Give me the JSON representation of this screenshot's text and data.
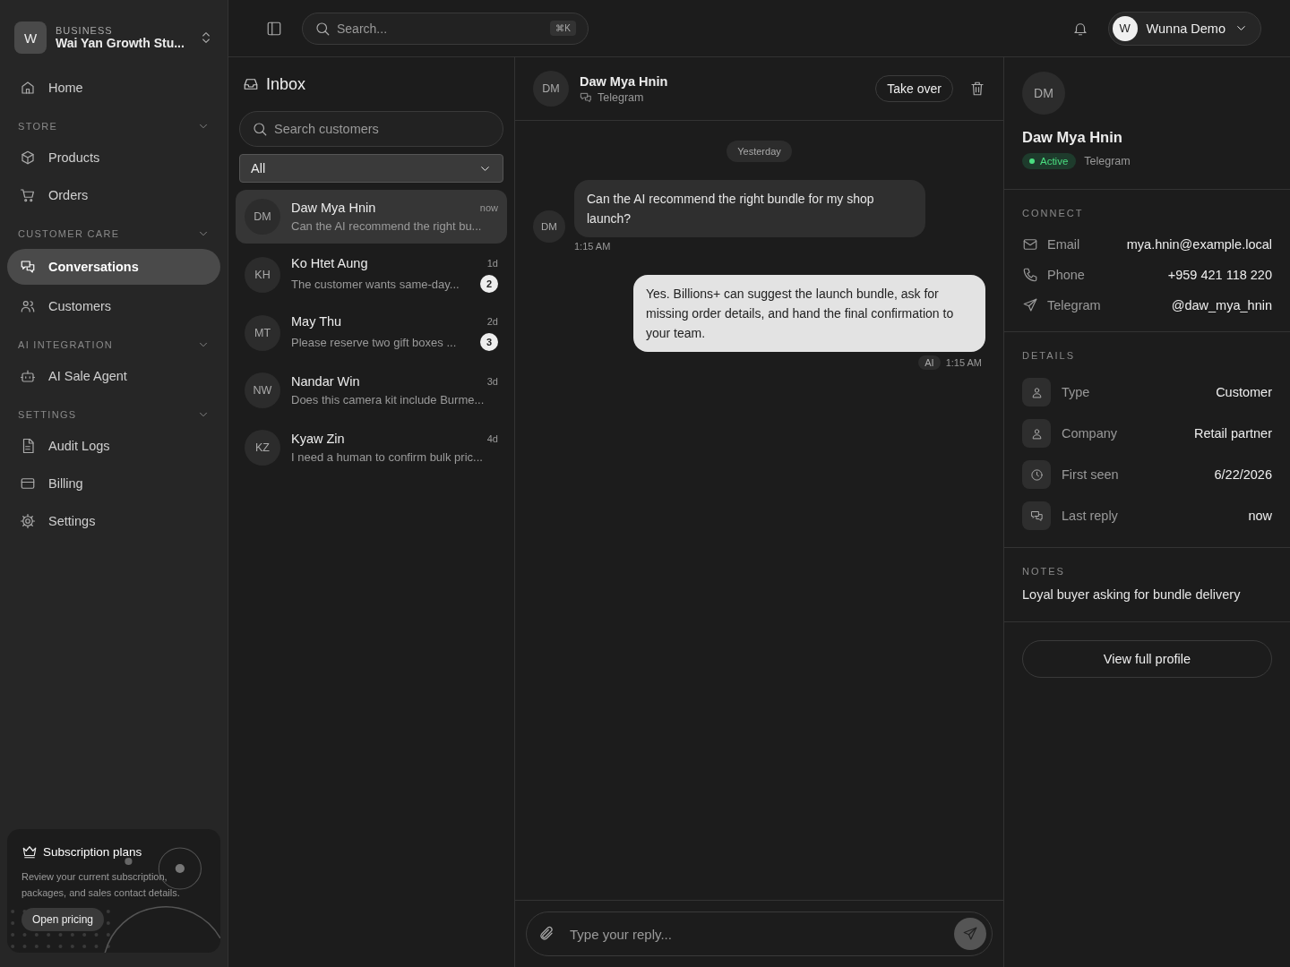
{
  "workspace": {
    "initial": "W",
    "label": "BUSINESS",
    "name": "Wai Yan Growth Stu..."
  },
  "nav": [
    {
      "items": [
        {
          "label": "Home",
          "selected": false
        }
      ]
    },
    {
      "title": "STORE",
      "expanded": true,
      "items": [
        {
          "label": "Products",
          "selected": false
        },
        {
          "label": "Orders",
          "selected": false
        }
      ]
    },
    {
      "title": "CUSTOMER CARE",
      "expanded": true,
      "items": [
        {
          "label": "Conversations",
          "selected": true
        },
        {
          "label": "Customers",
          "selected": false
        }
      ]
    },
    {
      "title": "AI INTEGRATION",
      "expanded": true,
      "items": [
        {
          "label": "AI Sale Agent",
          "selected": false
        }
      ]
    },
    {
      "title": "SETTINGS",
      "expanded": true,
      "items": [
        {
          "label": "Audit Logs",
          "selected": false
        },
        {
          "label": "Billing",
          "selected": false
        },
        {
          "label": "Settings",
          "selected": false
        }
      ]
    }
  ],
  "promo": {
    "title": "Subscription plans",
    "text": "Review your current subscription, packages, and sales contact details.",
    "button": "Open pricing"
  },
  "topbar": {
    "search": {
      "placeholder": "Search...",
      "shortcut": "⌘K"
    },
    "user": {
      "initial": "W",
      "name": "Wunna Demo"
    }
  },
  "inbox": {
    "title": "Inbox",
    "search": {
      "placeholder": "Search customers"
    },
    "filter": "All",
    "conversations": [
      {
        "initials": "DM",
        "name": "Daw Mya Hnin",
        "time": "now",
        "preview": "Can the AI recommend the right bu...",
        "selected": true
      },
      {
        "initials": "KH",
        "name": "Ko Htet Aung",
        "time": "1d",
        "preview": "The customer wants same-day...",
        "unread": "2",
        "selected": false
      },
      {
        "initials": "MT",
        "name": "May Thu",
        "time": "2d",
        "preview": "Please reserve two gift boxes ...",
        "unread": "3",
        "selected": false
      },
      {
        "initials": "NW",
        "name": "Nandar Win",
        "time": "3d",
        "preview": "Does this camera kit include Burme...",
        "selected": false
      },
      {
        "initials": "KZ",
        "name": "Kyaw Zin",
        "time": "4d",
        "preview": "I need a human to confirm bulk pric...",
        "selected": false
      }
    ]
  },
  "chat": {
    "initials": "DM",
    "name": "Daw Mya Hnin",
    "channel": "Telegram",
    "take_over": "Take over",
    "date": "Yesterday",
    "messages": [
      {
        "kind": "incoming",
        "initials": "DM",
        "text": "Can the AI recommend the right bundle for my shop launch?",
        "time": "1:15 AM"
      },
      {
        "kind": "outgoing",
        "tag": "AI",
        "text": "Yes. Billions+ can suggest the launch bundle, ask for missing order details, and hand the final confirmation to your team.",
        "time": "1:15 AM"
      }
    ],
    "composer": {
      "placeholder": "Type your reply..."
    }
  },
  "profile": {
    "initials": "DM",
    "name": "Daw Mya Hnin",
    "status": "Active",
    "channel": "Telegram",
    "connect": {
      "title": "CONNECT",
      "rows": [
        {
          "label": "Email",
          "value": "mya.hnin@example.local"
        },
        {
          "label": "Phone",
          "value": "+959 421 118 220"
        },
        {
          "label": "Telegram",
          "value": "@daw_mya_hnin"
        }
      ]
    },
    "details": {
      "title": "DETAILS",
      "rows": [
        {
          "label": "Type",
          "value": "Customer"
        },
        {
          "label": "Company",
          "value": "Retail partner"
        },
        {
          "label": "First seen",
          "value": "6/22/2026"
        },
        {
          "label": "Last reply",
          "value": "now"
        }
      ]
    },
    "notes": {
      "title": "NOTES",
      "text": "Loyal buyer asking for bundle delivery"
    },
    "button": "View full profile"
  }
}
